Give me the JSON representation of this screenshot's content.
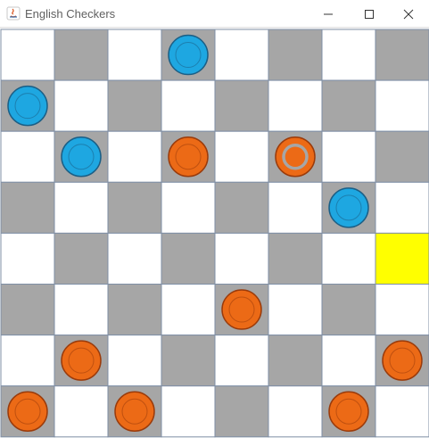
{
  "window": {
    "title": "English Checkers",
    "controls": {
      "minimize": "minimize",
      "maximize": "maximize",
      "close": "close"
    }
  },
  "board": {
    "size": 8,
    "colors": {
      "light_square": "#ffffff",
      "dark_square": "#a6a6a6",
      "highlight_square": "#ffff00",
      "grid_line": "#7f8fa6",
      "blue_piece": "#1ea7e1",
      "blue_piece_stroke": "#1b5f86",
      "orange_piece": "#ec6a16",
      "orange_piece_stroke": "#9a3b0b",
      "selected_ring": "#a6a6a6"
    },
    "highlighted": [
      {
        "row": 4,
        "col": 7
      }
    ],
    "pieces": [
      {
        "row": 0,
        "col": 3,
        "color": "blue"
      },
      {
        "row": 1,
        "col": 0,
        "color": "blue"
      },
      {
        "row": 2,
        "col": 1,
        "color": "blue"
      },
      {
        "row": 2,
        "col": 3,
        "color": "orange"
      },
      {
        "row": 2,
        "col": 5,
        "color": "orange",
        "selected": true
      },
      {
        "row": 3,
        "col": 6,
        "color": "blue"
      },
      {
        "row": 5,
        "col": 4,
        "color": "orange"
      },
      {
        "row": 6,
        "col": 1,
        "color": "orange"
      },
      {
        "row": 6,
        "col": 7,
        "color": "orange"
      },
      {
        "row": 7,
        "col": 0,
        "color": "orange"
      },
      {
        "row": 7,
        "col": 2,
        "color": "orange"
      },
      {
        "row": 7,
        "col": 6,
        "color": "orange"
      }
    ]
  }
}
